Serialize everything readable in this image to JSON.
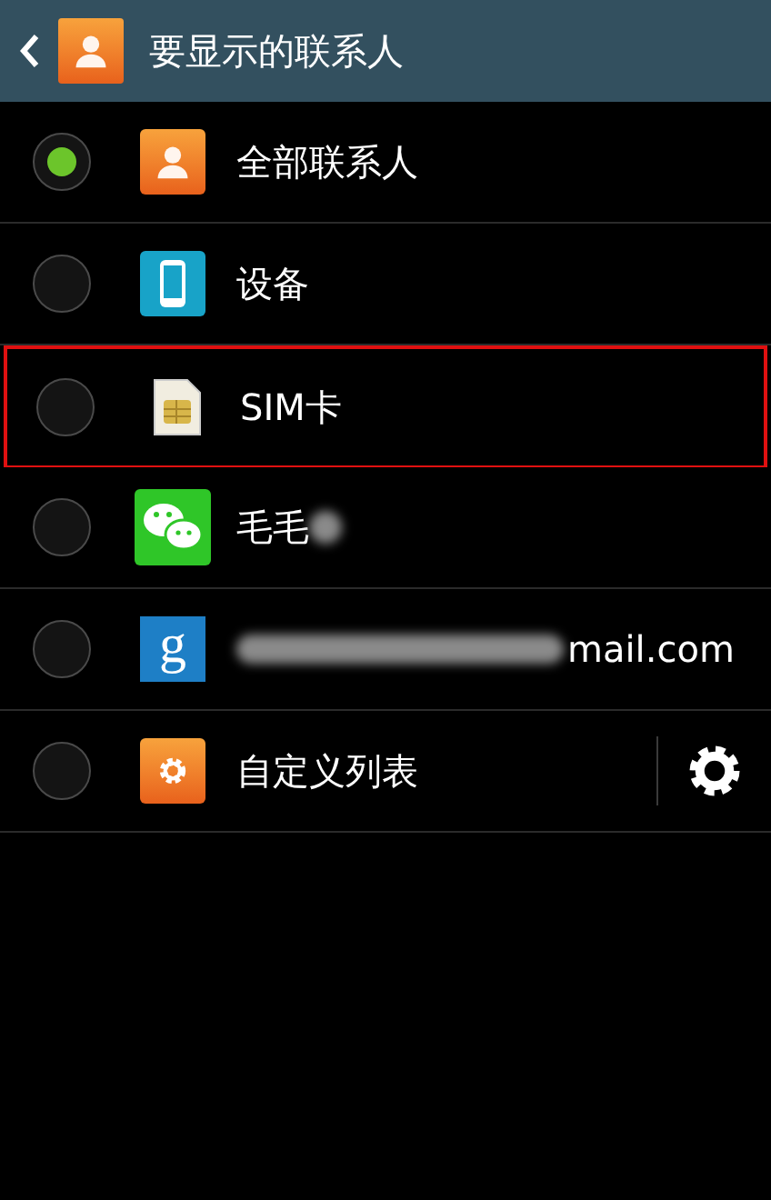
{
  "header": {
    "title": "要显示的联系人"
  },
  "items": [
    {
      "label": "全部联系人",
      "kind": "person",
      "selected": true,
      "highlighted": false,
      "blur_before": false,
      "blur_after": false,
      "settings": false
    },
    {
      "label": "设备",
      "kind": "phone",
      "selected": false,
      "highlighted": false,
      "blur_before": false,
      "blur_after": false,
      "settings": false
    },
    {
      "label": "SIM卡",
      "kind": "sim",
      "selected": false,
      "highlighted": true,
      "blur_before": false,
      "blur_after": false,
      "settings": false
    },
    {
      "label": "毛毛",
      "kind": "chat",
      "selected": false,
      "highlighted": false,
      "blur_before": false,
      "blur_after": true,
      "settings": false
    },
    {
      "label": "mail.com",
      "kind": "google",
      "icon_text": "g",
      "selected": false,
      "highlighted": false,
      "blur_before": true,
      "blur_after": false,
      "settings": false
    },
    {
      "label": "自定义列表",
      "kind": "gear",
      "selected": false,
      "highlighted": false,
      "blur_before": false,
      "blur_after": false,
      "settings": true
    }
  ]
}
